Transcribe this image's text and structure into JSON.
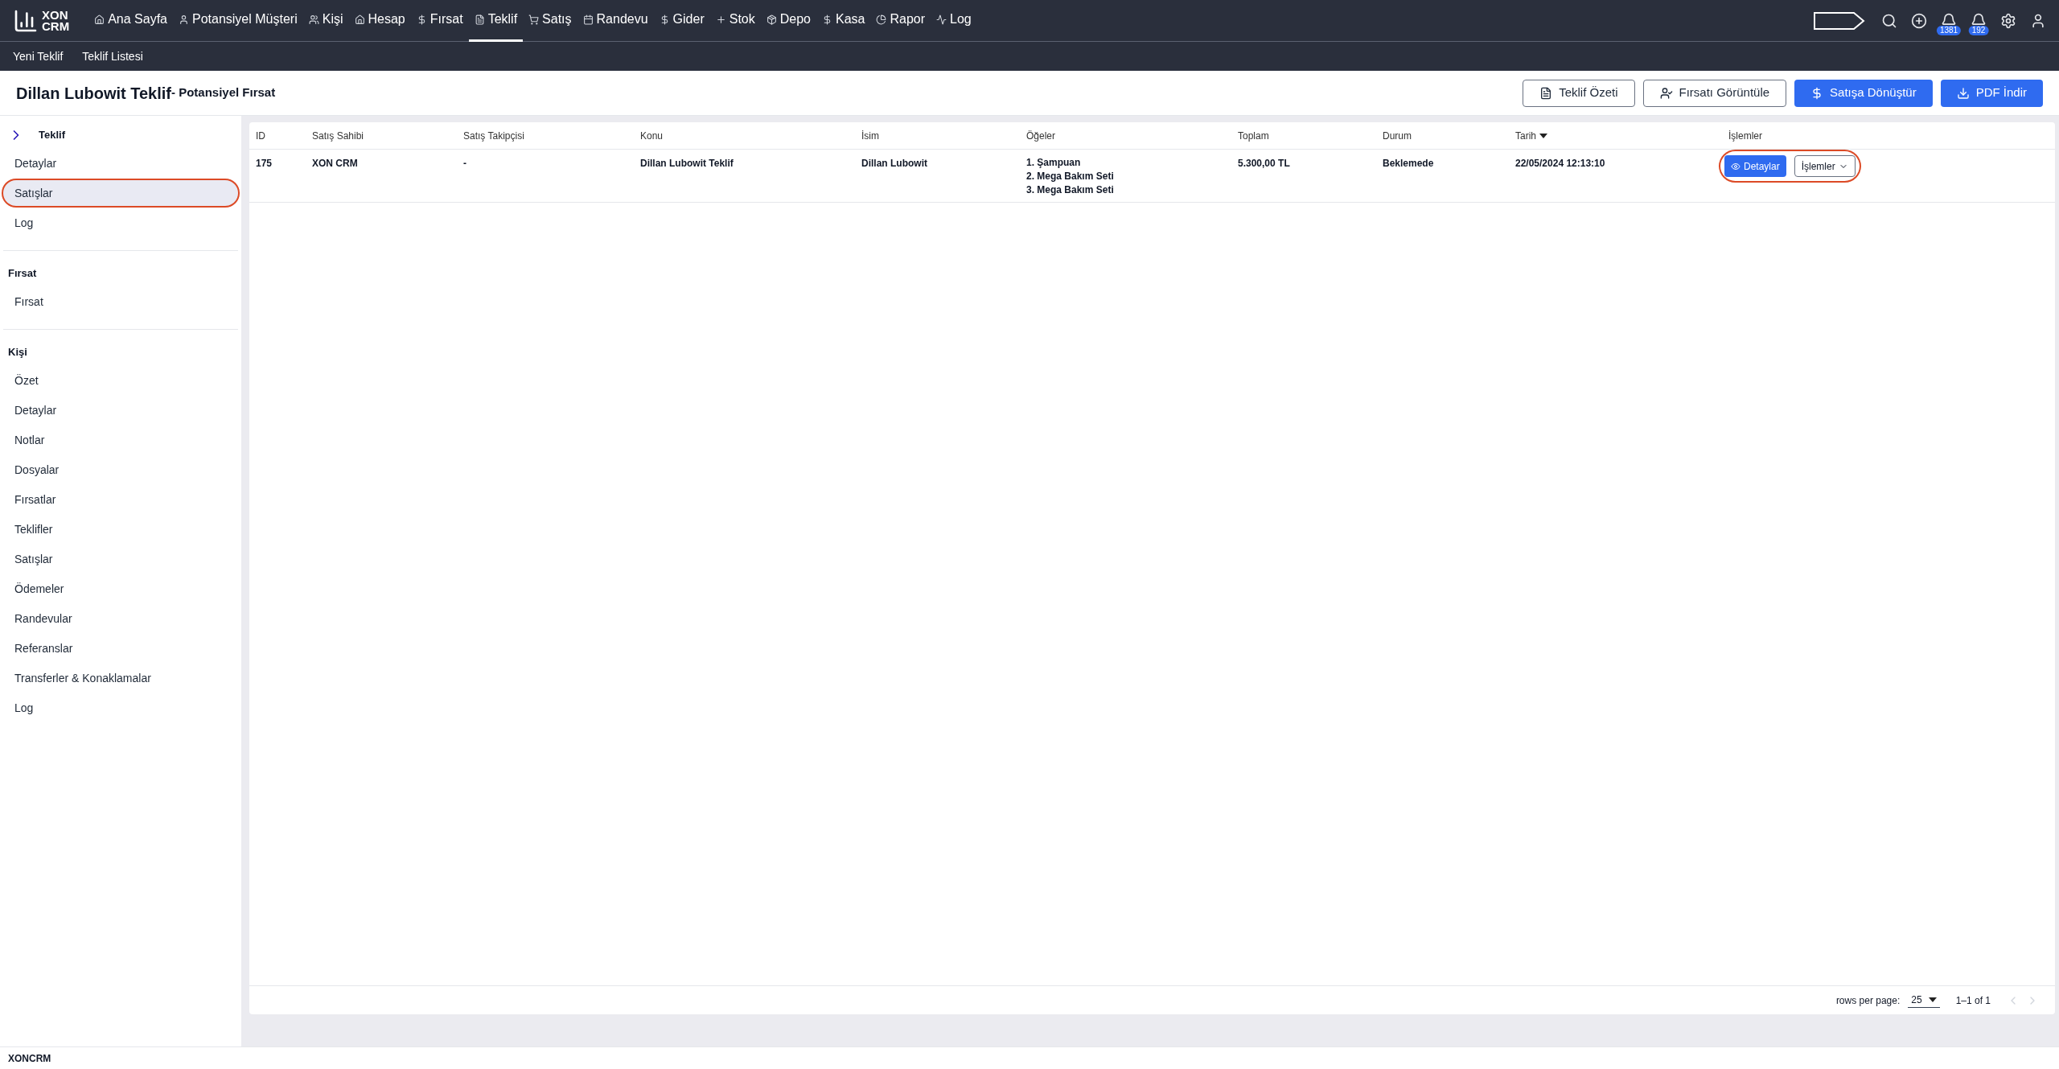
{
  "logo": {
    "line1": "XON",
    "line2": "CRM"
  },
  "nav": [
    {
      "label": "Ana Sayfa",
      "selected": false
    },
    {
      "label": "Potansiyel Müşteri",
      "selected": false
    },
    {
      "label": "Kişi",
      "selected": false
    },
    {
      "label": "Hesap",
      "selected": false
    },
    {
      "label": "Fırsat",
      "selected": false
    },
    {
      "label": "Teklif",
      "selected": true
    },
    {
      "label": "Satış",
      "selected": false
    },
    {
      "label": "Randevu",
      "selected": false
    },
    {
      "label": "Gider",
      "selected": false
    },
    {
      "label": "Stok",
      "selected": false
    },
    {
      "label": "Depo",
      "selected": false
    },
    {
      "label": "Kasa",
      "selected": false
    },
    {
      "label": "Rapor",
      "selected": false
    },
    {
      "label": "Log",
      "selected": false
    }
  ],
  "notifications": [
    {
      "count": "1381"
    },
    {
      "count": "192"
    }
  ],
  "subnav": [
    "Yeni Teklif",
    "Teklif Listesi"
  ],
  "page": {
    "title": "Dillan Lubowit Teklif",
    "subtitle": "- Potansiyel Fırsat"
  },
  "page_actions": [
    {
      "label": "Teklif Özeti",
      "kind": "outline"
    },
    {
      "label": "Fırsatı Görüntüle",
      "kind": "outline"
    },
    {
      "label": "Satışa Dönüştür",
      "kind": "primary"
    },
    {
      "label": "PDF İndir",
      "kind": "primary"
    }
  ],
  "sidebar": [
    {
      "title": "Teklif",
      "expandable": true,
      "items": [
        {
          "label": "Detaylar",
          "selected": false
        },
        {
          "label": "Satışlar",
          "selected": true
        },
        {
          "label": "Log",
          "selected": false
        }
      ]
    },
    {
      "title": "Fırsat",
      "items": [
        {
          "label": "Fırsat",
          "selected": false
        }
      ]
    },
    {
      "title": "Kişi",
      "items": [
        {
          "label": "Özet",
          "selected": false
        },
        {
          "label": "Detaylar",
          "selected": false
        },
        {
          "label": "Notlar",
          "selected": false
        },
        {
          "label": "Dosyalar",
          "selected": false
        },
        {
          "label": "Fırsatlar",
          "selected": false
        },
        {
          "label": "Teklifler",
          "selected": false
        },
        {
          "label": "Satışlar",
          "selected": false
        },
        {
          "label": "Ödemeler",
          "selected": false
        },
        {
          "label": "Randevular",
          "selected": false
        },
        {
          "label": "Referanslar",
          "selected": false
        },
        {
          "label": "Transferler & Konaklamalar",
          "selected": false
        },
        {
          "label": "Log",
          "selected": false
        }
      ]
    }
  ],
  "table": {
    "columns": [
      {
        "label": "ID",
        "sorted": false
      },
      {
        "label": "Satış Sahibi",
        "sorted": false
      },
      {
        "label": "Satış Takipçisi",
        "sorted": false
      },
      {
        "label": "Konu",
        "sorted": false
      },
      {
        "label": "İsim",
        "sorted": false
      },
      {
        "label": "Öğeler",
        "sorted": false
      },
      {
        "label": "Toplam",
        "sorted": false
      },
      {
        "label": "Durum",
        "sorted": false
      },
      {
        "label": "Tarih",
        "sorted": true
      },
      {
        "label": "İşlemler",
        "sorted": false
      }
    ],
    "rows": [
      {
        "cells": [
          "175",
          "XON CRM",
          "-",
          "Dillan Lubowit Teklif",
          "Dillan Lubowit"
        ],
        "items": [
          "1. Şampuan",
          "2. Mega Bakım Seti",
          "3. Mega Bakım Seti"
        ],
        "total": "5.300,00 TL",
        "status": "Beklemede",
        "date": "22/05/2024 12:13:10",
        "actions": [
          "Detaylar",
          "İşlemler"
        ],
        "actions_highlighted": true
      }
    ]
  },
  "pagination": {
    "rows_per_page_label": "rows per page:",
    "rows_per_page": "25",
    "range": "1–1 of 1"
  },
  "footer": "XONCRM"
}
